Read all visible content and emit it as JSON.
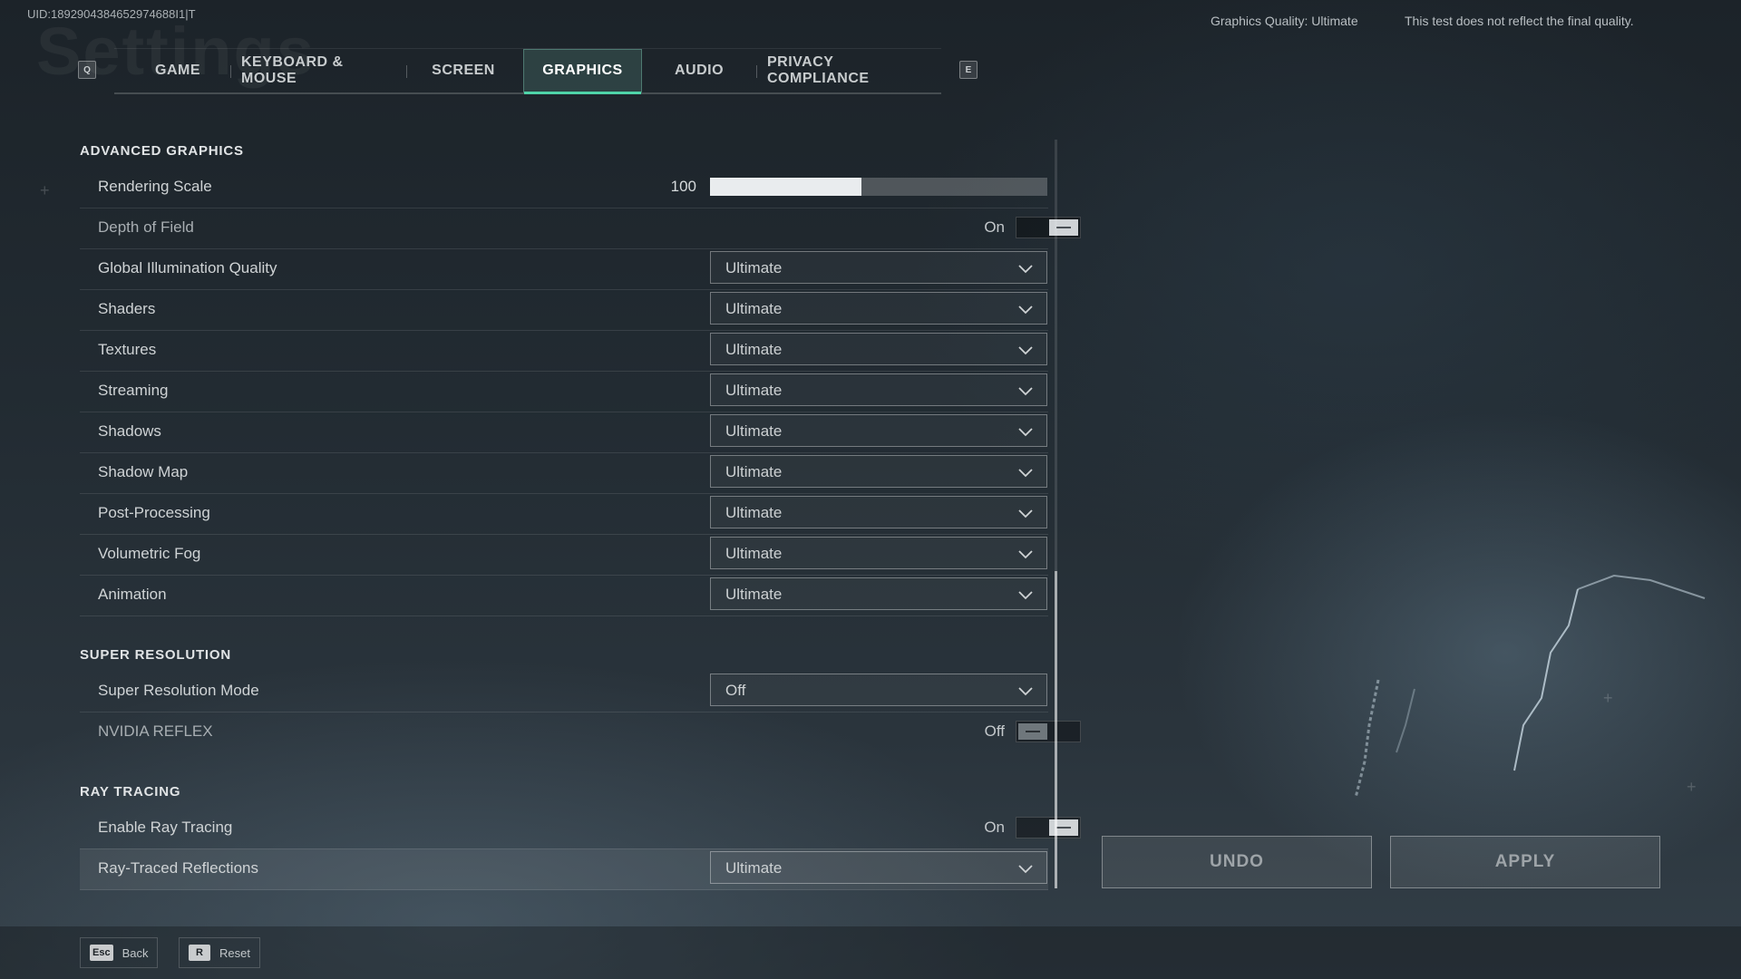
{
  "background_title": "Settings",
  "uid": "UID:1892904384652974688I1|T",
  "graphics_quality_note": "Graphics Quality: Ultimate",
  "disclaimer": "This test does not reflect the final quality.",
  "tabs": {
    "prev_key": "Q",
    "next_key": "E",
    "items": [
      {
        "label": "GAME"
      },
      {
        "label": "KEYBOARD & MOUSE"
      },
      {
        "label": "SCREEN"
      },
      {
        "label": "GRAPHICS",
        "active": true
      },
      {
        "label": "AUDIO"
      },
      {
        "label": "PRIVACY COMPLIANCE"
      }
    ]
  },
  "advanced_graphics": {
    "title": "ADVANCED GRAPHICS",
    "rendering_scale": {
      "label": "Rendering Scale",
      "value": "100",
      "fill_fraction": 0.45
    },
    "depth_of_field": {
      "label": "Depth of Field",
      "state": "On"
    },
    "global_illumination": {
      "label": "Global Illumination Quality",
      "value": "Ultimate"
    },
    "shaders": {
      "label": "Shaders",
      "value": "Ultimate"
    },
    "textures": {
      "label": "Textures",
      "value": "Ultimate"
    },
    "streaming": {
      "label": "Streaming",
      "value": "Ultimate"
    },
    "shadows": {
      "label": "Shadows",
      "value": "Ultimate"
    },
    "shadow_map": {
      "label": "Shadow Map",
      "value": "Ultimate"
    },
    "post_processing": {
      "label": "Post-Processing",
      "value": "Ultimate"
    },
    "volumetric_fog": {
      "label": "Volumetric Fog",
      "value": "Ultimate"
    },
    "animation": {
      "label": "Animation",
      "value": "Ultimate"
    }
  },
  "super_resolution": {
    "title": "SUPER RESOLUTION",
    "mode": {
      "label": "Super Resolution Mode",
      "value": "Off"
    },
    "nvidia_reflex": {
      "label": "NVIDIA REFLEX",
      "state": "Off"
    }
  },
  "ray_tracing": {
    "title": "RAY TRACING",
    "enable": {
      "label": "Enable Ray Tracing",
      "state": "On"
    },
    "reflections": {
      "label": "Ray-Traced Reflections",
      "value": "Ultimate"
    }
  },
  "actions": {
    "undo": "UNDO",
    "apply": "APPLY"
  },
  "footer": {
    "back": {
      "key": "Esc",
      "label": "Back"
    },
    "reset": {
      "key": "R",
      "label": "Reset"
    }
  },
  "colors": {
    "accent": "#4fd3a8"
  }
}
